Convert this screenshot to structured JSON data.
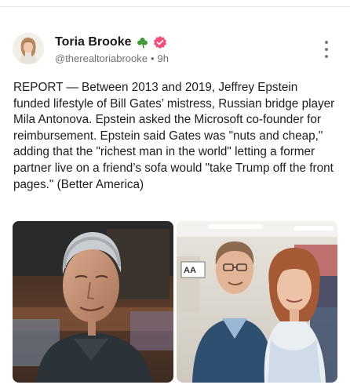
{
  "post": {
    "author": {
      "display_name": "Toria Brooke",
      "handle": "@therealtoriabrooke",
      "time": "9h",
      "badges": [
        "clover-icon",
        "verified-icon"
      ]
    },
    "body": "REPORT — Between 2013 and 2019, Jeffrey Epstein funded lifestyle of Bill Gates’ mistress, Russian bridge player Mila Antonova. Epstein asked the Microsoft co-founder for reimbursement. Epstein said Gates was \"nuts and cheap,\" adding that the \"richest man in the world\" letting a former partner live on a friend’s sofa would \"take Trump off the front pages.\" (Better America)",
    "media": [
      {
        "icon": "photo-man-portrait",
        "caption": ""
      },
      {
        "icon": "photo-two-people",
        "caption": ""
      }
    ],
    "sign_text": "AA"
  },
  "colors": {
    "verified": "#f0507a",
    "clover": "#3f9b3a",
    "meta": "#6f6f6f"
  }
}
